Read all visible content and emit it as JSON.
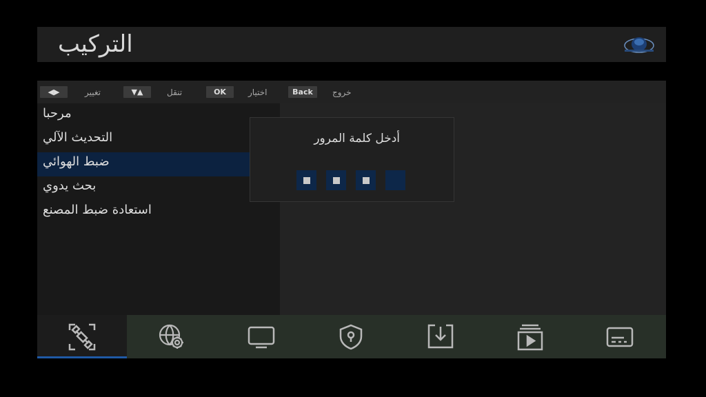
{
  "header": {
    "title": "التركيب",
    "logo_icon": "satellite-dish-logo-icon"
  },
  "hints": [
    {
      "key": "◀▶",
      "label": "تغيير"
    },
    {
      "key": "▼▲",
      "label": "تنقل"
    },
    {
      "key": "OK",
      "label": "اختيار"
    },
    {
      "key": "Back",
      "label": "خروج"
    }
  ],
  "menu": {
    "items": [
      {
        "label": "مرحبا"
      },
      {
        "label": "التحديث الآلي"
      },
      {
        "label": "ضبط الهوائي"
      },
      {
        "label": "بحث يدوي"
      },
      {
        "label": "استعادة ضبط المصنع"
      }
    ],
    "selected_index": 2
  },
  "dialog": {
    "prompt": "أدخل كلمة المرور",
    "pin_filled": 3,
    "pin_length": 4
  },
  "tabs": [
    {
      "icon": "satellite-install-icon",
      "active": true
    },
    {
      "icon": "network-settings-icon",
      "active": false
    },
    {
      "icon": "tv-display-icon",
      "active": false
    },
    {
      "icon": "security-lock-icon",
      "active": false
    },
    {
      "icon": "download-update-icon",
      "active": false
    },
    {
      "icon": "media-playlist-icon",
      "active": false
    },
    {
      "icon": "subtitle-info-icon",
      "active": false
    }
  ],
  "colors": {
    "accent": "#1f5aa6",
    "selection": "#0c2240",
    "footer": "#283028"
  }
}
